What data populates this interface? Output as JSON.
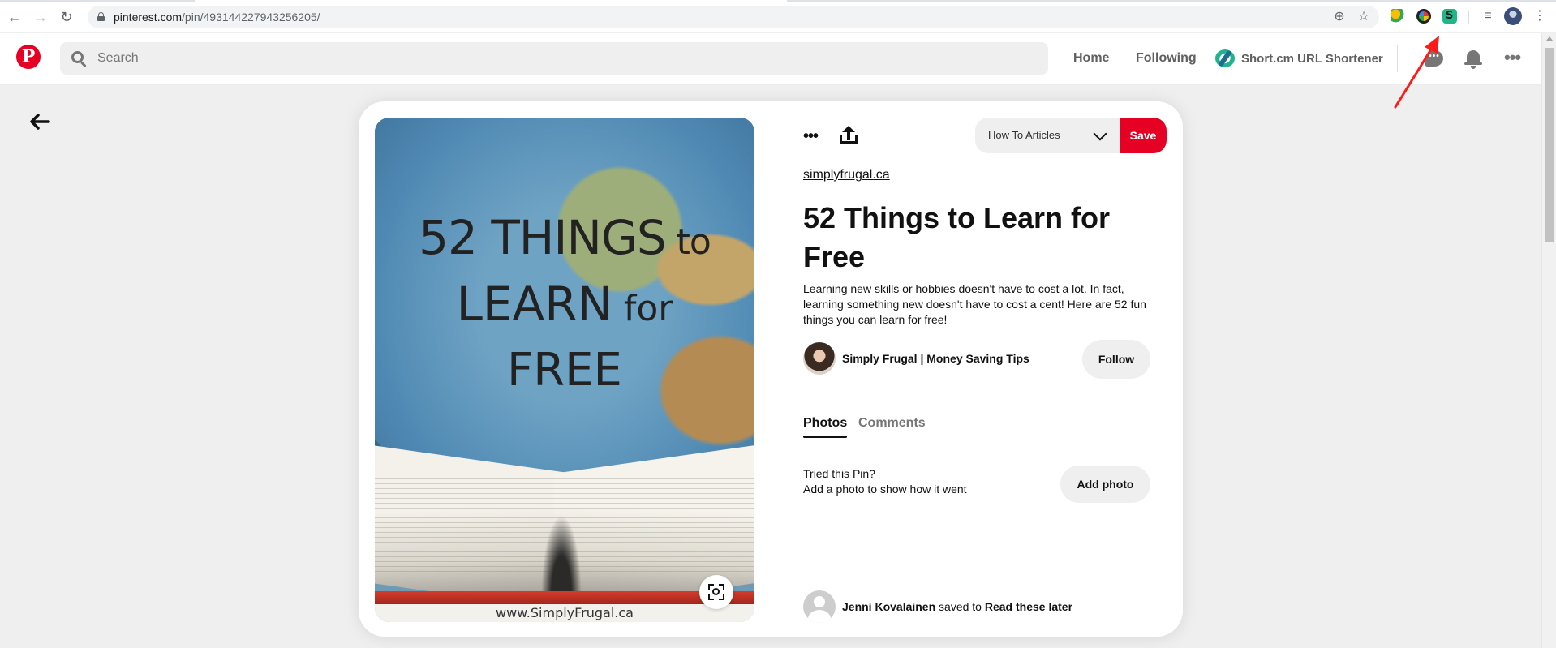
{
  "browser": {
    "url_host": "pinterest.com",
    "url_path": "/pin/493144227943256205/",
    "icons": [
      "back-icon",
      "forward-icon",
      "reload-icon",
      "lock-icon",
      "zoom-icon",
      "bookmark-star-icon",
      "reading-list-icon",
      "kebab-menu-icon"
    ],
    "glyphs": {
      "back": "←",
      "forward": "→",
      "reload": "↻",
      "zoom": "⊕",
      "star": "☆",
      "reading_list": "≡",
      "menu": "⋮"
    }
  },
  "header": {
    "logo_letter": "P",
    "search_placeholder": "Search",
    "nav": {
      "home": "Home",
      "following": "Following",
      "shortcm": "Short.cm URL Shortener"
    },
    "chat_glyph": "•••",
    "more_glyph": "•••"
  },
  "page": {
    "back_glyph": "🡐",
    "image": {
      "overlay_line1_main": "52 THINGS",
      "overlay_line1_small": " to",
      "overlay_line2_main": "LEARN",
      "overlay_line2_small": " for",
      "overlay_line3": "FREE",
      "watermark": "www.SimplyFrugal.ca"
    },
    "actions": {
      "more_glyph": "•••"
    },
    "board_select": "How To Articles",
    "save_label": "Save",
    "source": "simplyfrugal.ca",
    "title": "52 Things to Learn for Free",
    "description": "Learning new skills or hobbies doesn't have to cost a lot. In fact, learning something new doesn't have to cost a cent! Here are 52 fun things you can learn for free!",
    "creator": "Simply Frugal | Money Saving Tips",
    "follow_label": "Follow",
    "tabs": {
      "photos": "Photos",
      "comments": "Comments"
    },
    "tried": {
      "line1": "Tried this Pin?",
      "line2": "Add a photo to show how it went",
      "button": "Add photo"
    },
    "activity": {
      "user": "Jenni Kovalainen",
      "verb": " saved to ",
      "board": "Read these later"
    }
  },
  "colors": {
    "pinterest_red": "#e60023",
    "annotation_arrow": "#ff1a1a",
    "shortcm_green": "#21b38f"
  }
}
